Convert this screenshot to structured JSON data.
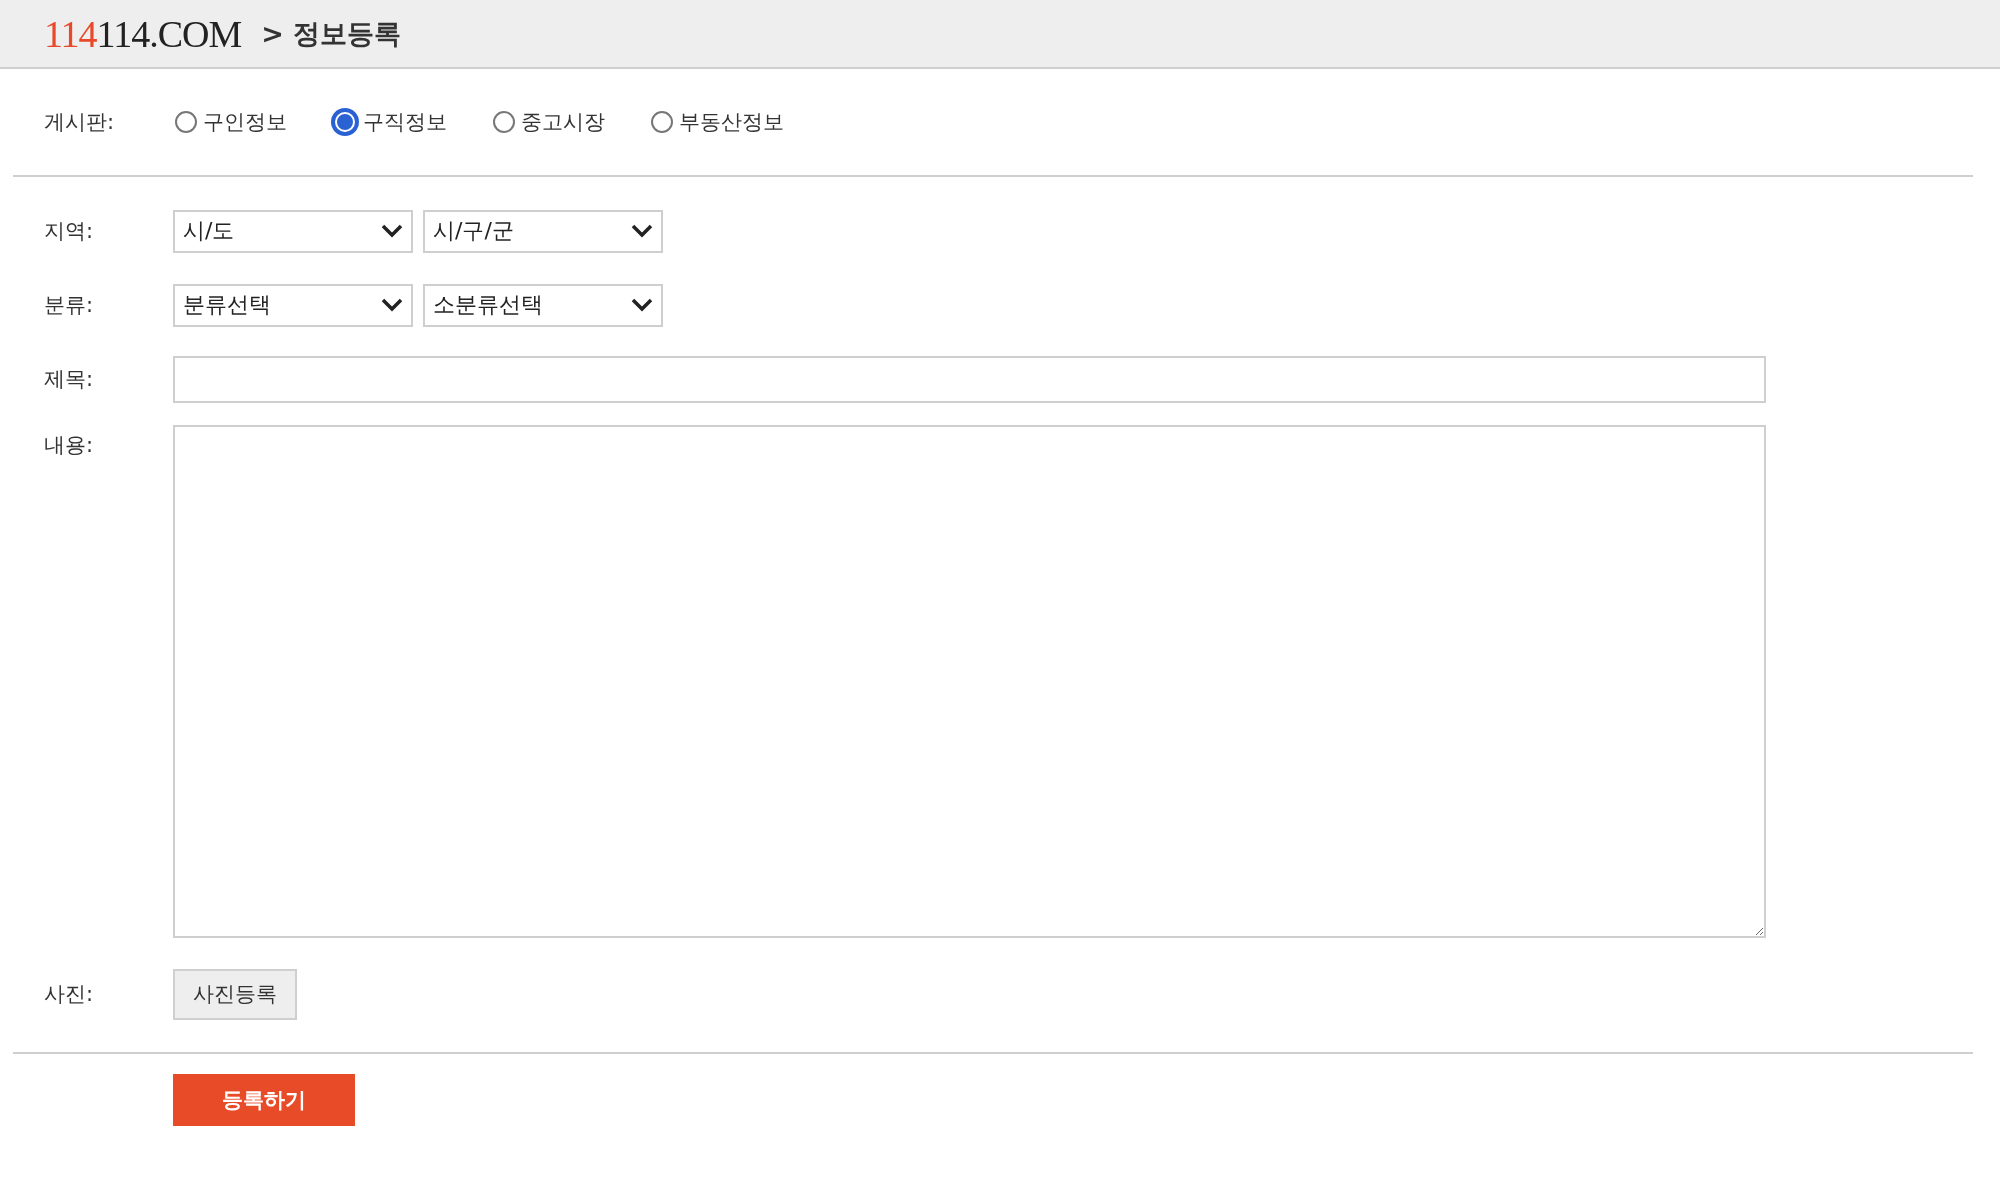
{
  "header": {
    "logo_accent": "114",
    "logo_rest": "114.COM",
    "breadcrumb": "> 정보등록"
  },
  "board": {
    "label": "게시판:",
    "options": [
      {
        "label": "구인정보",
        "selected": false
      },
      {
        "label": "구직정보",
        "selected": true
      },
      {
        "label": "중고시장",
        "selected": false
      },
      {
        "label": "부동산정보",
        "selected": false
      }
    ]
  },
  "region": {
    "label": "지역:",
    "selects": [
      "시/도",
      "시/구/군"
    ]
  },
  "category": {
    "label": "분류:",
    "selects": [
      "분류선택",
      "소분류선택"
    ]
  },
  "title": {
    "label": "제목:"
  },
  "content": {
    "label": "내용:"
  },
  "photo": {
    "label": "사진:",
    "button": "사진등록"
  },
  "submit": "등록하기"
}
